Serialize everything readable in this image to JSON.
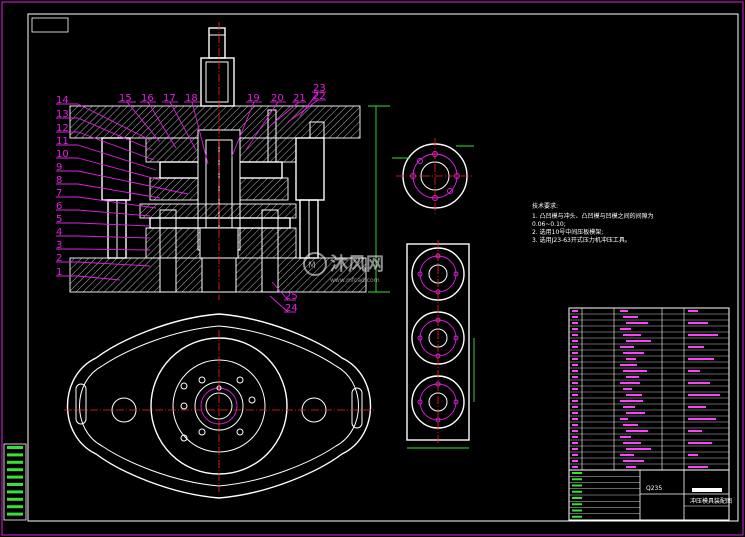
{
  "colors": {
    "background": "#000000",
    "outline": "#ffffff",
    "centerline": "#ff2020",
    "leader": "#e020e0",
    "dimension": "#38e038",
    "frame": "#e020e0"
  },
  "part_numbers_left": [
    "14",
    "13",
    "12",
    "11",
    "10",
    "9",
    "8",
    "7",
    "6",
    "5",
    "4",
    "3",
    "2",
    "1"
  ],
  "part_numbers_top": [
    "15",
    "16",
    "17",
    "18",
    "19",
    "20",
    "21",
    "22",
    "23"
  ],
  "part_numbers_bottom": [
    "25",
    "24"
  ],
  "technical_notes": {
    "heading": "技术要求:",
    "lines": [
      "1. 凸凹模与冲头、凸凹模与凹模之间的间隙为",
      "0.06~0.10;",
      "2. 选用10号中间压板模架;",
      "3. 选用J23-63开式压力机冲压工具。"
    ]
  },
  "title_block": {
    "material": "Q235",
    "drawing_name": "冲压模具装配图"
  },
  "watermark": {
    "brand": "沐风网",
    "url": "www.mfcad.com"
  }
}
